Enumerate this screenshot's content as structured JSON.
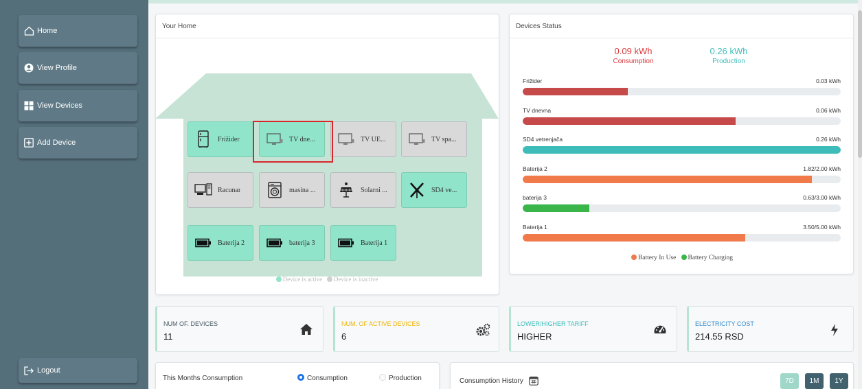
{
  "sidebar": {
    "items": [
      {
        "label": "Home",
        "icon": "home-icon"
      },
      {
        "label": "View Profile",
        "icon": "user-circle-icon"
      },
      {
        "label": "View Devices",
        "icon": "grid-icon"
      },
      {
        "label": "Add Device",
        "icon": "plus-square-icon"
      }
    ],
    "logout_label": "Logout"
  },
  "home": {
    "title": "Your Home",
    "devices": [
      {
        "label": "Frižider",
        "icon": "fridge-icon",
        "active": true
      },
      {
        "label": "TV dne...",
        "icon": "tv-icon",
        "active": true
      },
      {
        "label": "TV UE...",
        "icon": "tv-icon",
        "active": false
      },
      {
        "label": "TV spa...",
        "icon": "tv-icon",
        "active": false
      },
      {
        "label": "Racunar",
        "icon": "computer-icon",
        "active": false
      },
      {
        "label": "masina ...",
        "icon": "washing-machine-icon",
        "active": false
      },
      {
        "label": "Solarni ...",
        "icon": "solar-panel-icon",
        "active": false
      },
      {
        "label": "SD4 ve...",
        "icon": "wind-turbine-icon",
        "active": true
      },
      {
        "label": "Baterija 2",
        "icon": "battery-icon",
        "active": true
      },
      {
        "label": "baterija 3",
        "icon": "battery-icon",
        "active": true
      },
      {
        "label": "Baterija 1",
        "icon": "battery-icon",
        "active": true
      }
    ],
    "legend_active": "Device is active",
    "legend_inactive": "Device is inactive"
  },
  "status": {
    "title": "Devices Status",
    "consumption_value": "0.09 kWh",
    "consumption_label": "Consumption",
    "production_value": "0.26 kWh",
    "production_label": "Production",
    "bars": [
      {
        "label": "Frižider",
        "value": "0.03 kWh",
        "fraction": 0.33,
        "color": "#c64a4a"
      },
      {
        "label": "TV dnevna",
        "value": "0.06 kWh",
        "fraction": 0.67,
        "color": "#c64a4a"
      },
      {
        "label": "SD4 vetrenjača",
        "value": "0.26 kWh",
        "fraction": 1.0,
        "color": "#3ebcb9"
      },
      {
        "label": "Baterija 2",
        "value": "1.82/2.00 kWh",
        "fraction": 0.91,
        "color": "#f07a4a"
      },
      {
        "label": "baterija 3",
        "value": "0.63/3.00 kWh",
        "fraction": 0.21,
        "color": "#39b54a"
      },
      {
        "label": "Baterija 1",
        "value": "3.50/5.00 kWh",
        "fraction": 0.7,
        "color": "#f07a4a"
      }
    ],
    "legend_in_use": "Battery In Use",
    "legend_charging": "Battery Charging"
  },
  "kpis": [
    {
      "label": "NUM OF. DEVICES",
      "value": "11",
      "icon": "house-icon",
      "label_color": "#4a5a62"
    },
    {
      "label": "NUM. OF ACTIVE DEVICES",
      "value": "6",
      "icon": "gears-icon",
      "label_color": "#f0b400"
    },
    {
      "label": "LOWER/HIGHER TARIFF",
      "value": "HIGHER",
      "icon": "gauge-icon",
      "label_color": "#3ebcb9"
    },
    {
      "label": "ELECTRICITY COST",
      "value": "214.55 RSD",
      "icon": "bolt-icon",
      "label_color": "#3a8fd0"
    }
  ],
  "month": {
    "title": "This Months Consumption",
    "option_consumption": "Consumption",
    "option_production": "Production"
  },
  "history": {
    "title": "Consumption History",
    "ranges": [
      "7D",
      "1M",
      "1Y"
    ]
  },
  "colors": {
    "sidebar": "#546e7a",
    "active_device": "#8fe4c9",
    "inactive_device": "#d9d9d9",
    "consumption": "#d9363a",
    "production": "#3ebcb9"
  }
}
